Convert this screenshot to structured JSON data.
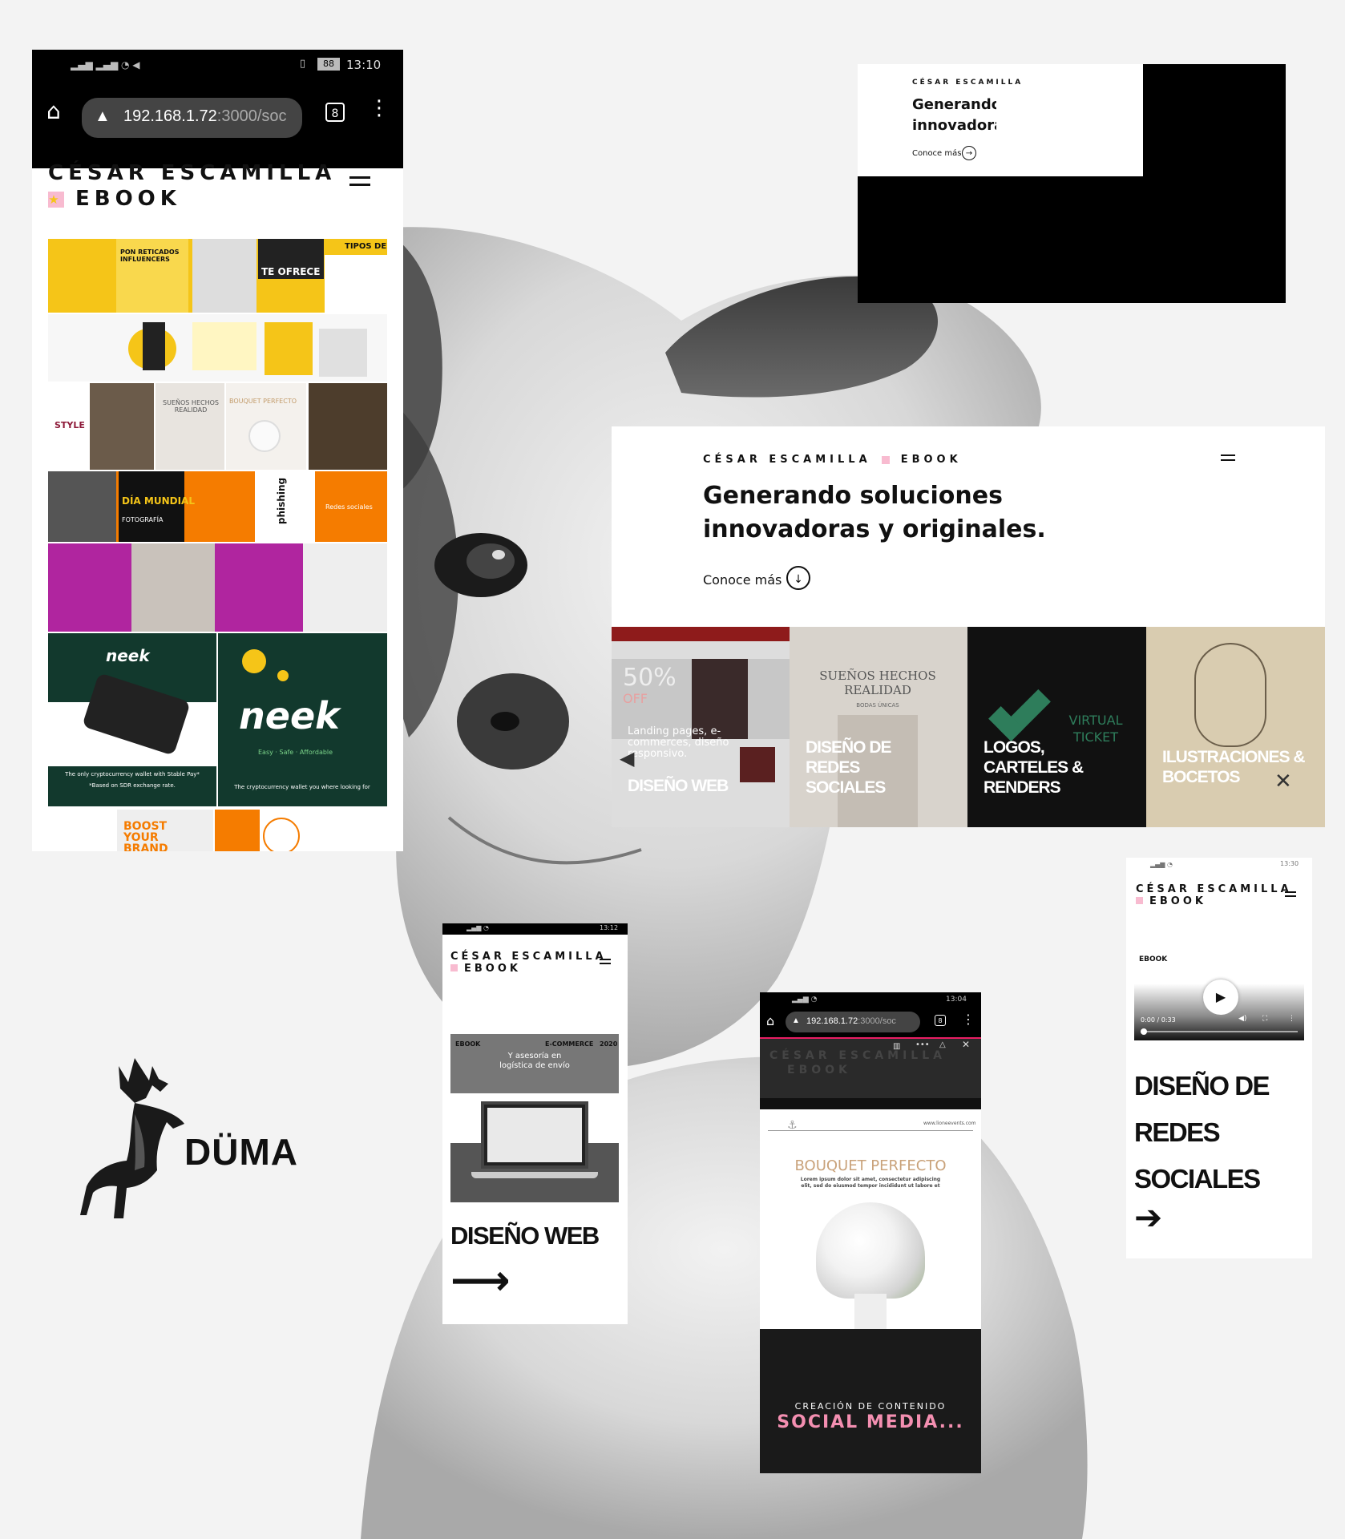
{
  "colors": {
    "accent_yellow": "#f5c518",
    "accent_orange": "#f57c00",
    "accent_magenta": "#b0259f",
    "neek_green": "#12392d",
    "black": "#000000",
    "white": "#ffffff",
    "pink": "#f48fb1"
  },
  "phone1": {
    "status_time": "13:10",
    "battery": "88",
    "url_host": "192.168.1.72",
    "url_rest": ":3000/soc",
    "tab_count": "8",
    "brand_line1": "CÉSAR ESCAMILLA",
    "brand_line2": "EBOOK",
    "grid_texts": {
      "influencers": "PON RETICADOS INFLUENCERS",
      "te_ofrece": "TE OFRECE",
      "tipos": "TIPOS DE",
      "style": "STYLE",
      "suenos": "SUEÑOS HECHOS REALIDAD",
      "bouquet": "BOUQUET PERFECTO",
      "dia": "DÍA MUNDIAL",
      "fotografia": "FOTOGRAFÍA",
      "phishing": "phishing",
      "redes": "Redes sociales",
      "neek": "neek",
      "neek_tag1": "The only cryptocurrency wallet with Stable Pay*",
      "neek_tag2": "*Based on SDR exchange rate.",
      "neek_slogan": "Easy · Safe · Affordable",
      "neek_tag3": "The cryptocurrency wallet you where looking for",
      "boost": "BOOST YOUR BRAND"
    }
  },
  "hero_small": {
    "brand": "CÉSAR ESCAMILLA",
    "headline1": "Generando soluciones",
    "headline2": "innovadoras y originales.",
    "cta": "Conoce más"
  },
  "desktop": {
    "brand": "CÉSAR ESCAMILLA",
    "brand_suffix": "EBOOK",
    "headline1": "Generando soluciones",
    "headline2": "innovadoras y originales.",
    "cta": "Conoce más",
    "tiles": [
      {
        "label": "DISEÑO WEB",
        "sub": "Landing pages, e-commerces, diseño responsivo.",
        "promo": "50%",
        "promo2": "OFF"
      },
      {
        "label": "DISEÑO DE REDES SOCIALES",
        "sub": "SUEÑOS HECHOS REALIDAD",
        "sub2": "BODAS ÚNICAS"
      },
      {
        "label": "LOGOS, CARTELES & RENDERS",
        "sub": "VIRTUAL TICKET"
      },
      {
        "label": "ILUSTRACIONES & BOCETOS"
      }
    ]
  },
  "phone_web": {
    "status_time": "13:12",
    "brand_line1": "CÉSAR ESCAMILLA",
    "brand_line2": "EBOOK",
    "card_left": "EBOOK",
    "card_right": "E-COMMERCE",
    "card_year": "2020",
    "card_text1": "Y asesoría en",
    "card_text2": "logística de envío",
    "title": "DISEÑO WEB"
  },
  "phone_browser": {
    "status_time": "13:04",
    "url_host": "192.168.1.72",
    "url_rest": ":3000/soc",
    "tab_count": "8",
    "brand_line1": "CÉSAR ESCAMILLA",
    "brand_line2": "EBOOK",
    "site_url": "www.lioneevents.com",
    "card_title": "BOUQUET PERFECTO",
    "card_body1": "Lorem ipsum dolor sit amet, consectetur adipiscing",
    "card_body2": "elit, sed do eiusmod tempor incididunt ut labore et",
    "banner_small": "CREACIÓN DE CONTENIDO",
    "banner_big": "SOCIAL MEDIA..."
  },
  "phone_redes": {
    "status_time": "13:30",
    "brand_line1": "CÉSAR ESCAMILLA",
    "brand_line2": "EBOOK",
    "video_label": "EBOOK",
    "video_time": "0:00 / 0:33",
    "title1": "DISEÑO DE",
    "title2": "REDES",
    "title3": "SOCIALES"
  },
  "logo": {
    "name": "DÜMA"
  }
}
